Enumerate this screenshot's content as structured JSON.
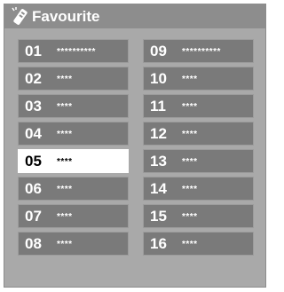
{
  "header": {
    "title": "Favourite",
    "icon": "remote-control-icon"
  },
  "left_list": [
    {
      "number": "01",
      "name": "**********"
    },
    {
      "number": "02",
      "name": "****"
    },
    {
      "number": "03",
      "name": "****"
    },
    {
      "number": "04",
      "name": "****"
    },
    {
      "number": "05",
      "name": "****"
    },
    {
      "number": "06",
      "name": "****"
    },
    {
      "number": "07",
      "name": "****"
    },
    {
      "number": "08",
      "name": "****"
    }
  ],
  "right_list": [
    {
      "number": "09",
      "name": "**********"
    },
    {
      "number": "10",
      "name": "****"
    },
    {
      "number": "11",
      "name": "****"
    },
    {
      "number": "12",
      "name": "****"
    },
    {
      "number": "13",
      "name": "****"
    },
    {
      "number": "14",
      "name": "****"
    },
    {
      "number": "15",
      "name": "****"
    },
    {
      "number": "16",
      "name": "****"
    }
  ],
  "selected_number": "05",
  "colors": {
    "panel": "#a9a9a9",
    "header": "#8d8d8d",
    "item": "#7a7a7a",
    "selected": "#ffffff"
  }
}
